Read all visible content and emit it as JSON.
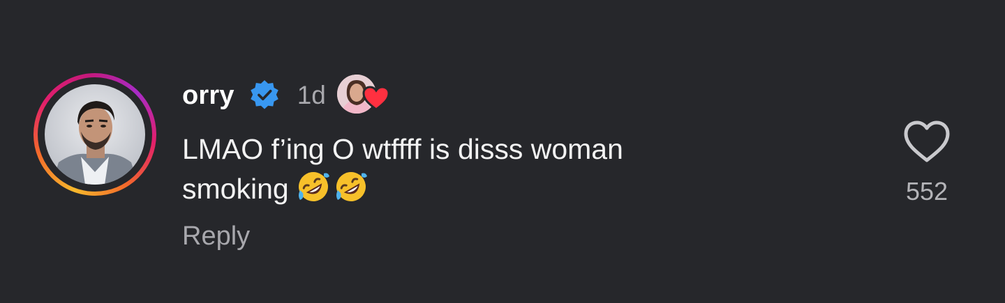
{
  "comment": {
    "username": "orry",
    "verified": true,
    "timestamp": "1d",
    "text_line_1": "LMAO f’ing O wtffff is disss woman",
    "text_line_2": "smoking",
    "emojis": [
      "rolling-on-floor-laughing",
      "rolling-on-floor-laughing"
    ],
    "reply_label": "Reply",
    "like_count": "552",
    "liked_by_author": true
  },
  "colors": {
    "background": "#26272b",
    "verified_blue": "#3897f0",
    "heart_red": "#ff3040",
    "muted_text": "#a8a8ad"
  },
  "icons": {
    "verified": "verified-badge-icon",
    "heart": "heart-outline-icon",
    "creator_like": "creator-heart-icon"
  }
}
